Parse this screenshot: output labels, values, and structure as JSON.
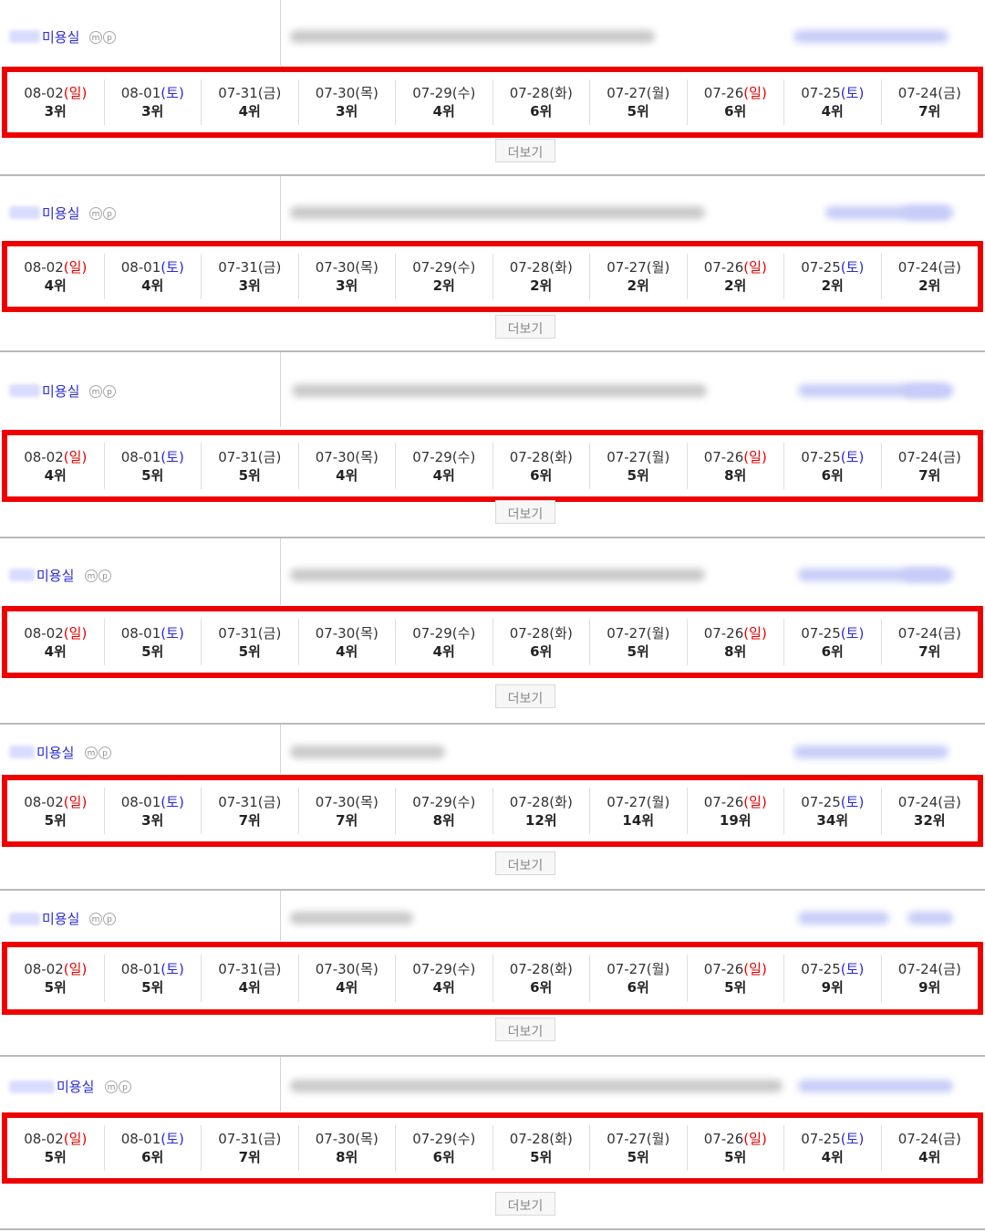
{
  "more_label": "더보기",
  "shop_label": "미용실",
  "icon_m": "m",
  "icon_p": "p",
  "weekday_colors": {
    "sun": "#e60000",
    "sat": "#2a2ad8",
    "border": "#ee0000"
  },
  "dates": [
    {
      "md": "08-02",
      "wd": "일",
      "kind": "sun"
    },
    {
      "md": "08-01",
      "wd": "토",
      "kind": "sat"
    },
    {
      "md": "07-31",
      "wd": "금",
      "kind": "norm"
    },
    {
      "md": "07-30",
      "wd": "목",
      "kind": "norm"
    },
    {
      "md": "07-29",
      "wd": "수",
      "kind": "norm"
    },
    {
      "md": "07-28",
      "wd": "화",
      "kind": "norm"
    },
    {
      "md": "07-27",
      "wd": "월",
      "kind": "norm"
    },
    {
      "md": "07-26",
      "wd": "일",
      "kind": "sun"
    },
    {
      "md": "07-25",
      "wd": "토",
      "kind": "sat"
    },
    {
      "md": "07-24",
      "wd": "금",
      "kind": "norm"
    }
  ],
  "entries": [
    {
      "ranks": [
        "3위",
        "3위",
        "4위",
        "3위",
        "4위",
        "6위",
        "5위",
        "6위",
        "4위",
        "7위"
      ]
    },
    {
      "ranks": [
        "4위",
        "4위",
        "3위",
        "3위",
        "2위",
        "2위",
        "2위",
        "2위",
        "2위",
        "2위"
      ]
    },
    {
      "ranks": [
        "4위",
        "5위",
        "5위",
        "4위",
        "4위",
        "6위",
        "5위",
        "8위",
        "6위",
        "7위"
      ]
    },
    {
      "ranks": [
        "4위",
        "5위",
        "5위",
        "4위",
        "4위",
        "6위",
        "5위",
        "8위",
        "6위",
        "7위"
      ]
    },
    {
      "ranks": [
        "5위",
        "3위",
        "7위",
        "7위",
        "8위",
        "12위",
        "14위",
        "19위",
        "34위",
        "32위"
      ]
    },
    {
      "ranks": [
        "5위",
        "5위",
        "4위",
        "4위",
        "4위",
        "6위",
        "6위",
        "5위",
        "9위",
        "9위"
      ]
    },
    {
      "ranks": [
        "5위",
        "6위",
        "7위",
        "8위",
        "6위",
        "5위",
        "5위",
        "5위",
        "4위",
        "4위"
      ]
    }
  ]
}
